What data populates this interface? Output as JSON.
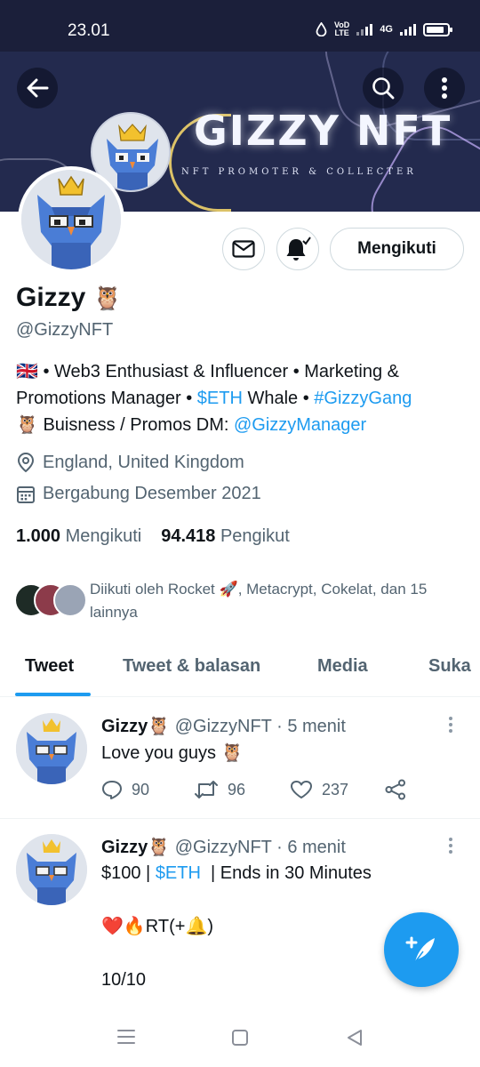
{
  "status_bar": {
    "time": "23.01",
    "network_volte_line1": "VoD",
    "network_volte_line2": "LTE",
    "network_type": "4G",
    "battery_level": 0.85
  },
  "banner": {
    "title": "GIZZY NFT",
    "subtitle": "NFT PROMOTER & COLLECTER"
  },
  "header": {
    "back_icon": "arrow-left-icon",
    "search_icon": "search-icon",
    "more_icon": "more-vertical-icon"
  },
  "profile": {
    "name": "Gizzy",
    "name_emoji": "🦉",
    "handle": "@GizzyNFT",
    "follow_button": "Mengikuti",
    "bio": {
      "flag": "🇬🇧",
      "part1": " • Web3 Enthusiast & Influencer • Marketing & Promotions Manager • ",
      "eth": "$ETH",
      "part2": " Whale • ",
      "hashtag": "#GizzyGang",
      "part3_emoji": "🦉",
      "part3": " Buisness / Promos DM: ",
      "mention": "@GizzyManager"
    },
    "location": "England, United Kingdom",
    "joined": "Bergabung Desember 2021",
    "following_count": "1.000",
    "following_label": "Mengikuti",
    "followers_count": "94.418",
    "followers_label": "Pengikut",
    "followed_by_a": "Diikuti oleh Rocket ",
    "followed_by_rocket": "🚀",
    "followed_by_b": ", Metacrypt, Cokelat, dan 15 lainnya"
  },
  "tabs": [
    "Tweet",
    "Tweet & balasan",
    "Media",
    "Suka"
  ],
  "tweets": [
    {
      "name": "Gizzy",
      "emoji": "🦉",
      "handle": "@GizzyNFT",
      "time": "· 5 menit",
      "text": "Love you guys 🦉",
      "replies": "90",
      "retweets": "96",
      "likes": "237"
    },
    {
      "name": "Gizzy",
      "emoji": "🦉",
      "handle": "@GizzyNFT",
      "time": "· 6 menit",
      "line1_a": "$100 | ",
      "line1_eth": "$ETH",
      "line1_b": "  | Ends in 30 Minutes",
      "line2": "❤️🔥RT(+🔔)",
      "line3": "10/10"
    }
  ],
  "colors": {
    "accent": "#1d9bf0",
    "banner_bg": "#232a4e",
    "status_bar_bg": "#1b1f3a",
    "text_primary": "#0f1419",
    "text_secondary": "#536471"
  }
}
